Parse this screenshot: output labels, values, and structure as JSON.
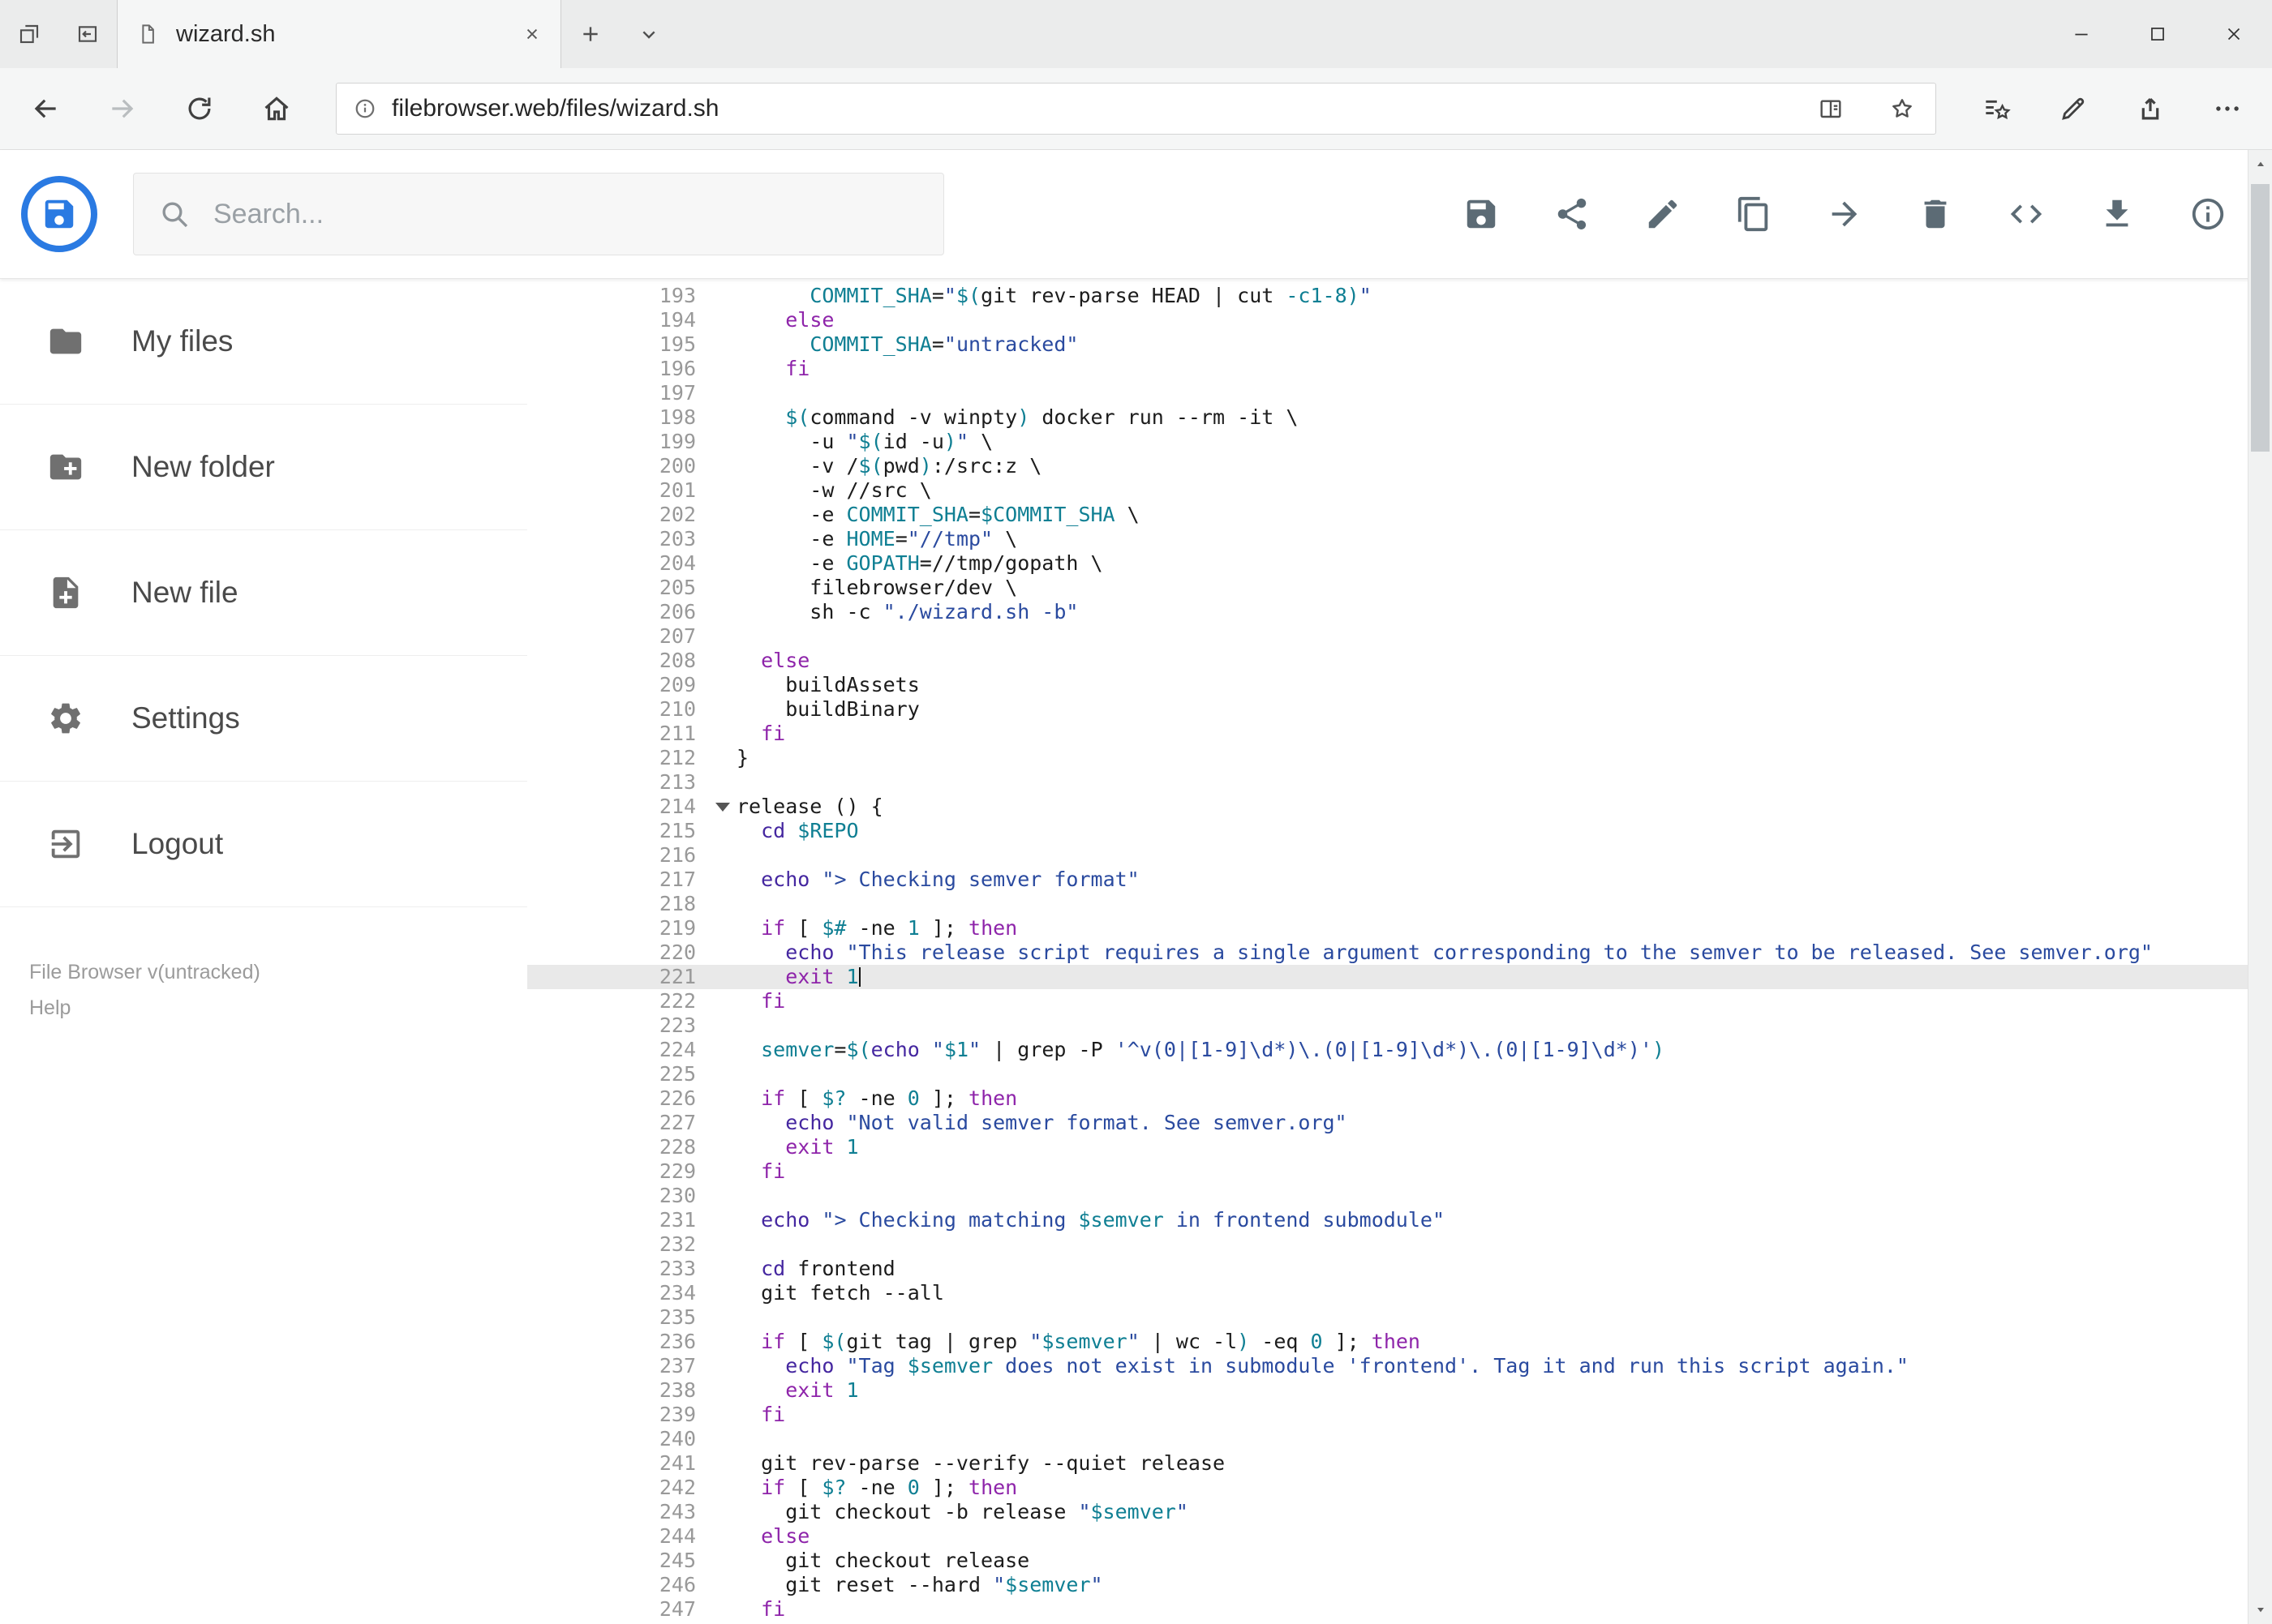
{
  "browser": {
    "tab_title": "wizard.sh",
    "url": "filebrowser.web/files/wizard.sh",
    "tab_strip_icons": [
      "tabs-aside",
      "tab-preview",
      "new-tab",
      "tab-list-chevron"
    ],
    "nav_icons": [
      "back",
      "forward",
      "refresh",
      "home"
    ],
    "urlbar_icons": [
      "site-info",
      "reading-view",
      "favorite-star"
    ],
    "nav_right_icons": [
      "hub",
      "web-note",
      "share",
      "more"
    ],
    "window_controls": [
      "minimize",
      "maximize",
      "close"
    ]
  },
  "header": {
    "search_placeholder": "Search...",
    "actions": [
      {
        "icon": "save"
      },
      {
        "icon": "share"
      },
      {
        "icon": "edit"
      },
      {
        "icon": "copy"
      },
      {
        "icon": "move"
      },
      {
        "icon": "delete"
      },
      {
        "icon": "code"
      },
      {
        "icon": "download"
      },
      {
        "icon": "info"
      }
    ]
  },
  "sidebar": {
    "items": [
      {
        "icon": "folder",
        "label": "My files"
      },
      {
        "icon": "new-folder",
        "label": "New folder"
      },
      {
        "icon": "new-file",
        "label": "New file"
      },
      {
        "icon": "settings",
        "label": "Settings"
      },
      {
        "icon": "logout",
        "label": "Logout"
      }
    ],
    "footer_version": "File Browser v(untracked)",
    "footer_help": "Help"
  },
  "colors": {
    "brand_blue": "#2a7ae2",
    "token_keyword": "#8e24aa",
    "token_builtin": "#4527a0",
    "token_variable": "#0f7f93",
    "token_number": "#0f7f93",
    "token_string": "#2a4a9f",
    "active_line_bg": "#e9e9e9"
  },
  "editor": {
    "active_line": 221,
    "fold_marker_line": 214,
    "lines": [
      {
        "n": 193,
        "t": [
          [
            "p",
            "      "
          ],
          [
            "v",
            "COMMIT_SHA"
          ],
          [
            "p",
            "="
          ],
          [
            "s",
            "\""
          ],
          [
            "v",
            "$("
          ],
          [
            "p",
            "git rev-parse HEAD | cut "
          ],
          [
            "n",
            "-c1-8"
          ],
          [
            "v",
            ")"
          ],
          [
            "s",
            "\""
          ]
        ]
      },
      {
        "n": 194,
        "t": [
          [
            "p",
            "    "
          ],
          [
            "k",
            "else"
          ]
        ]
      },
      {
        "n": 195,
        "t": [
          [
            "p",
            "      "
          ],
          [
            "v",
            "COMMIT_SHA"
          ],
          [
            "p",
            "="
          ],
          [
            "s",
            "\"untracked\""
          ]
        ]
      },
      {
        "n": 196,
        "t": [
          [
            "p",
            "    "
          ],
          [
            "k",
            "fi"
          ]
        ]
      },
      {
        "n": 197,
        "t": []
      },
      {
        "n": 198,
        "t": [
          [
            "p",
            "    "
          ],
          [
            "v",
            "$("
          ],
          [
            "p",
            "command -v winpty"
          ],
          [
            "v",
            ")"
          ],
          [
            "p",
            " docker run --rm -it \\"
          ]
        ]
      },
      {
        "n": 199,
        "t": [
          [
            "p",
            "      -u "
          ],
          [
            "s",
            "\""
          ],
          [
            "v",
            "$("
          ],
          [
            "p",
            "id -u"
          ],
          [
            "v",
            ")"
          ],
          [
            "s",
            "\""
          ],
          [
            "p",
            " \\"
          ]
        ]
      },
      {
        "n": 200,
        "t": [
          [
            "p",
            "      -v /"
          ],
          [
            "v",
            "$("
          ],
          [
            "p",
            "pwd"
          ],
          [
            "v",
            ")"
          ],
          [
            "p",
            ":/src:z \\"
          ]
        ]
      },
      {
        "n": 201,
        "t": [
          [
            "p",
            "      -w //src \\"
          ]
        ]
      },
      {
        "n": 202,
        "t": [
          [
            "p",
            "      -e "
          ],
          [
            "v",
            "COMMIT_SHA"
          ],
          [
            "p",
            "="
          ],
          [
            "v",
            "$COMMIT_SHA"
          ],
          [
            "p",
            " \\"
          ]
        ]
      },
      {
        "n": 203,
        "t": [
          [
            "p",
            "      -e "
          ],
          [
            "v",
            "HOME"
          ],
          [
            "p",
            "="
          ],
          [
            "s",
            "\"//tmp\""
          ],
          [
            "p",
            " \\"
          ]
        ]
      },
      {
        "n": 204,
        "t": [
          [
            "p",
            "      -e "
          ],
          [
            "v",
            "GOPATH"
          ],
          [
            "p",
            "=//tmp/gopath \\"
          ]
        ]
      },
      {
        "n": 205,
        "t": [
          [
            "p",
            "      filebrowser/dev \\"
          ]
        ]
      },
      {
        "n": 206,
        "t": [
          [
            "p",
            "      sh -c "
          ],
          [
            "s",
            "\"./wizard.sh -b\""
          ]
        ]
      },
      {
        "n": 207,
        "t": []
      },
      {
        "n": 208,
        "t": [
          [
            "p",
            "  "
          ],
          [
            "k",
            "else"
          ]
        ]
      },
      {
        "n": 209,
        "t": [
          [
            "p",
            "    buildAssets"
          ]
        ]
      },
      {
        "n": 210,
        "t": [
          [
            "p",
            "    buildBinary"
          ]
        ]
      },
      {
        "n": 211,
        "t": [
          [
            "p",
            "  "
          ],
          [
            "k",
            "fi"
          ]
        ]
      },
      {
        "n": 212,
        "t": [
          [
            "p",
            "}"
          ]
        ]
      },
      {
        "n": 213,
        "t": []
      },
      {
        "n": 214,
        "t": [
          [
            "p",
            "release () {"
          ]
        ]
      },
      {
        "n": 215,
        "t": [
          [
            "p",
            "  "
          ],
          [
            "b",
            "cd"
          ],
          [
            "p",
            " "
          ],
          [
            "v",
            "$REPO"
          ]
        ]
      },
      {
        "n": 216,
        "t": []
      },
      {
        "n": 217,
        "t": [
          [
            "p",
            "  "
          ],
          [
            "b",
            "echo"
          ],
          [
            "p",
            " "
          ],
          [
            "s",
            "\"> Checking semver format\""
          ]
        ]
      },
      {
        "n": 218,
        "t": []
      },
      {
        "n": 219,
        "t": [
          [
            "p",
            "  "
          ],
          [
            "k",
            "if"
          ],
          [
            "p",
            " [ "
          ],
          [
            "v",
            "$#"
          ],
          [
            "p",
            " -ne "
          ],
          [
            "n",
            "1"
          ],
          [
            "p",
            " ]; "
          ],
          [
            "k",
            "then"
          ]
        ]
      },
      {
        "n": 220,
        "t": [
          [
            "p",
            "    "
          ],
          [
            "b",
            "echo"
          ],
          [
            "p",
            " "
          ],
          [
            "s",
            "\"This release script requires a single argument corresponding to the semver to be released. See semver.org\""
          ]
        ]
      },
      {
        "n": 221,
        "t": [
          [
            "p",
            "    "
          ],
          [
            "k",
            "exit"
          ],
          [
            "p",
            " "
          ],
          [
            "n",
            "1"
          ]
        ]
      },
      {
        "n": 222,
        "t": [
          [
            "p",
            "  "
          ],
          [
            "k",
            "fi"
          ]
        ]
      },
      {
        "n": 223,
        "t": []
      },
      {
        "n": 224,
        "t": [
          [
            "p",
            "  "
          ],
          [
            "v",
            "semver"
          ],
          [
            "p",
            "="
          ],
          [
            "v",
            "$("
          ],
          [
            "b",
            "echo"
          ],
          [
            "p",
            " "
          ],
          [
            "s",
            "\""
          ],
          [
            "v",
            "$1"
          ],
          [
            "s",
            "\""
          ],
          [
            "p",
            " | grep -P "
          ],
          [
            "s",
            "'^v(0|[1-9]\\d*)\\.(0|[1-9]\\d*)\\.(0|[1-9]\\d*)'"
          ],
          [
            "v",
            ")"
          ]
        ]
      },
      {
        "n": 225,
        "t": []
      },
      {
        "n": 226,
        "t": [
          [
            "p",
            "  "
          ],
          [
            "k",
            "if"
          ],
          [
            "p",
            " [ "
          ],
          [
            "v",
            "$?"
          ],
          [
            "p",
            " -ne "
          ],
          [
            "n",
            "0"
          ],
          [
            "p",
            " ]; "
          ],
          [
            "k",
            "then"
          ]
        ]
      },
      {
        "n": 227,
        "t": [
          [
            "p",
            "    "
          ],
          [
            "b",
            "echo"
          ],
          [
            "p",
            " "
          ],
          [
            "s",
            "\"Not valid semver format. See semver.org\""
          ]
        ]
      },
      {
        "n": 228,
        "t": [
          [
            "p",
            "    "
          ],
          [
            "k",
            "exit"
          ],
          [
            "p",
            " "
          ],
          [
            "n",
            "1"
          ]
        ]
      },
      {
        "n": 229,
        "t": [
          [
            "p",
            "  "
          ],
          [
            "k",
            "fi"
          ]
        ]
      },
      {
        "n": 230,
        "t": []
      },
      {
        "n": 231,
        "t": [
          [
            "p",
            "  "
          ],
          [
            "b",
            "echo"
          ],
          [
            "p",
            " "
          ],
          [
            "s",
            "\"> Checking matching "
          ],
          [
            "v",
            "$semver"
          ],
          [
            "s",
            " in frontend submodule\""
          ]
        ]
      },
      {
        "n": 232,
        "t": []
      },
      {
        "n": 233,
        "t": [
          [
            "p",
            "  "
          ],
          [
            "b",
            "cd"
          ],
          [
            "p",
            " frontend"
          ]
        ]
      },
      {
        "n": 234,
        "t": [
          [
            "p",
            "  git fetch --all"
          ]
        ]
      },
      {
        "n": 235,
        "t": []
      },
      {
        "n": 236,
        "t": [
          [
            "p",
            "  "
          ],
          [
            "k",
            "if"
          ],
          [
            "p",
            " [ "
          ],
          [
            "v",
            "$("
          ],
          [
            "p",
            "git tag | grep "
          ],
          [
            "s",
            "\""
          ],
          [
            "v",
            "$semver"
          ],
          [
            "s",
            "\""
          ],
          [
            "p",
            " | wc -l"
          ],
          [
            "v",
            ")"
          ],
          [
            "p",
            " -eq "
          ],
          [
            "n",
            "0"
          ],
          [
            "p",
            " ]; "
          ],
          [
            "k",
            "then"
          ]
        ]
      },
      {
        "n": 237,
        "t": [
          [
            "p",
            "    "
          ],
          [
            "b",
            "echo"
          ],
          [
            "p",
            " "
          ],
          [
            "s",
            "\"Tag "
          ],
          [
            "v",
            "$semver"
          ],
          [
            "s",
            " does not exist in submodule 'frontend'. Tag it and run this script again.\""
          ]
        ]
      },
      {
        "n": 238,
        "t": [
          [
            "p",
            "    "
          ],
          [
            "k",
            "exit"
          ],
          [
            "p",
            " "
          ],
          [
            "n",
            "1"
          ]
        ]
      },
      {
        "n": 239,
        "t": [
          [
            "p",
            "  "
          ],
          [
            "k",
            "fi"
          ]
        ]
      },
      {
        "n": 240,
        "t": []
      },
      {
        "n": 241,
        "t": [
          [
            "p",
            "  git rev-parse --verify --quiet release"
          ]
        ]
      },
      {
        "n": 242,
        "t": [
          [
            "p",
            "  "
          ],
          [
            "k",
            "if"
          ],
          [
            "p",
            " [ "
          ],
          [
            "v",
            "$?"
          ],
          [
            "p",
            " -ne "
          ],
          [
            "n",
            "0"
          ],
          [
            "p",
            " ]; "
          ],
          [
            "k",
            "then"
          ]
        ]
      },
      {
        "n": 243,
        "t": [
          [
            "p",
            "    git checkout -b release "
          ],
          [
            "s",
            "\""
          ],
          [
            "v",
            "$semver"
          ],
          [
            "s",
            "\""
          ]
        ]
      },
      {
        "n": 244,
        "t": [
          [
            "p",
            "  "
          ],
          [
            "k",
            "else"
          ]
        ]
      },
      {
        "n": 245,
        "t": [
          [
            "p",
            "    git checkout release"
          ]
        ]
      },
      {
        "n": 246,
        "t": [
          [
            "p",
            "    git reset --hard "
          ],
          [
            "s",
            "\""
          ],
          [
            "v",
            "$semver"
          ],
          [
            "s",
            "\""
          ]
        ]
      },
      {
        "n": 247,
        "t": [
          [
            "p",
            "  "
          ],
          [
            "k",
            "fi"
          ]
        ]
      }
    ]
  }
}
